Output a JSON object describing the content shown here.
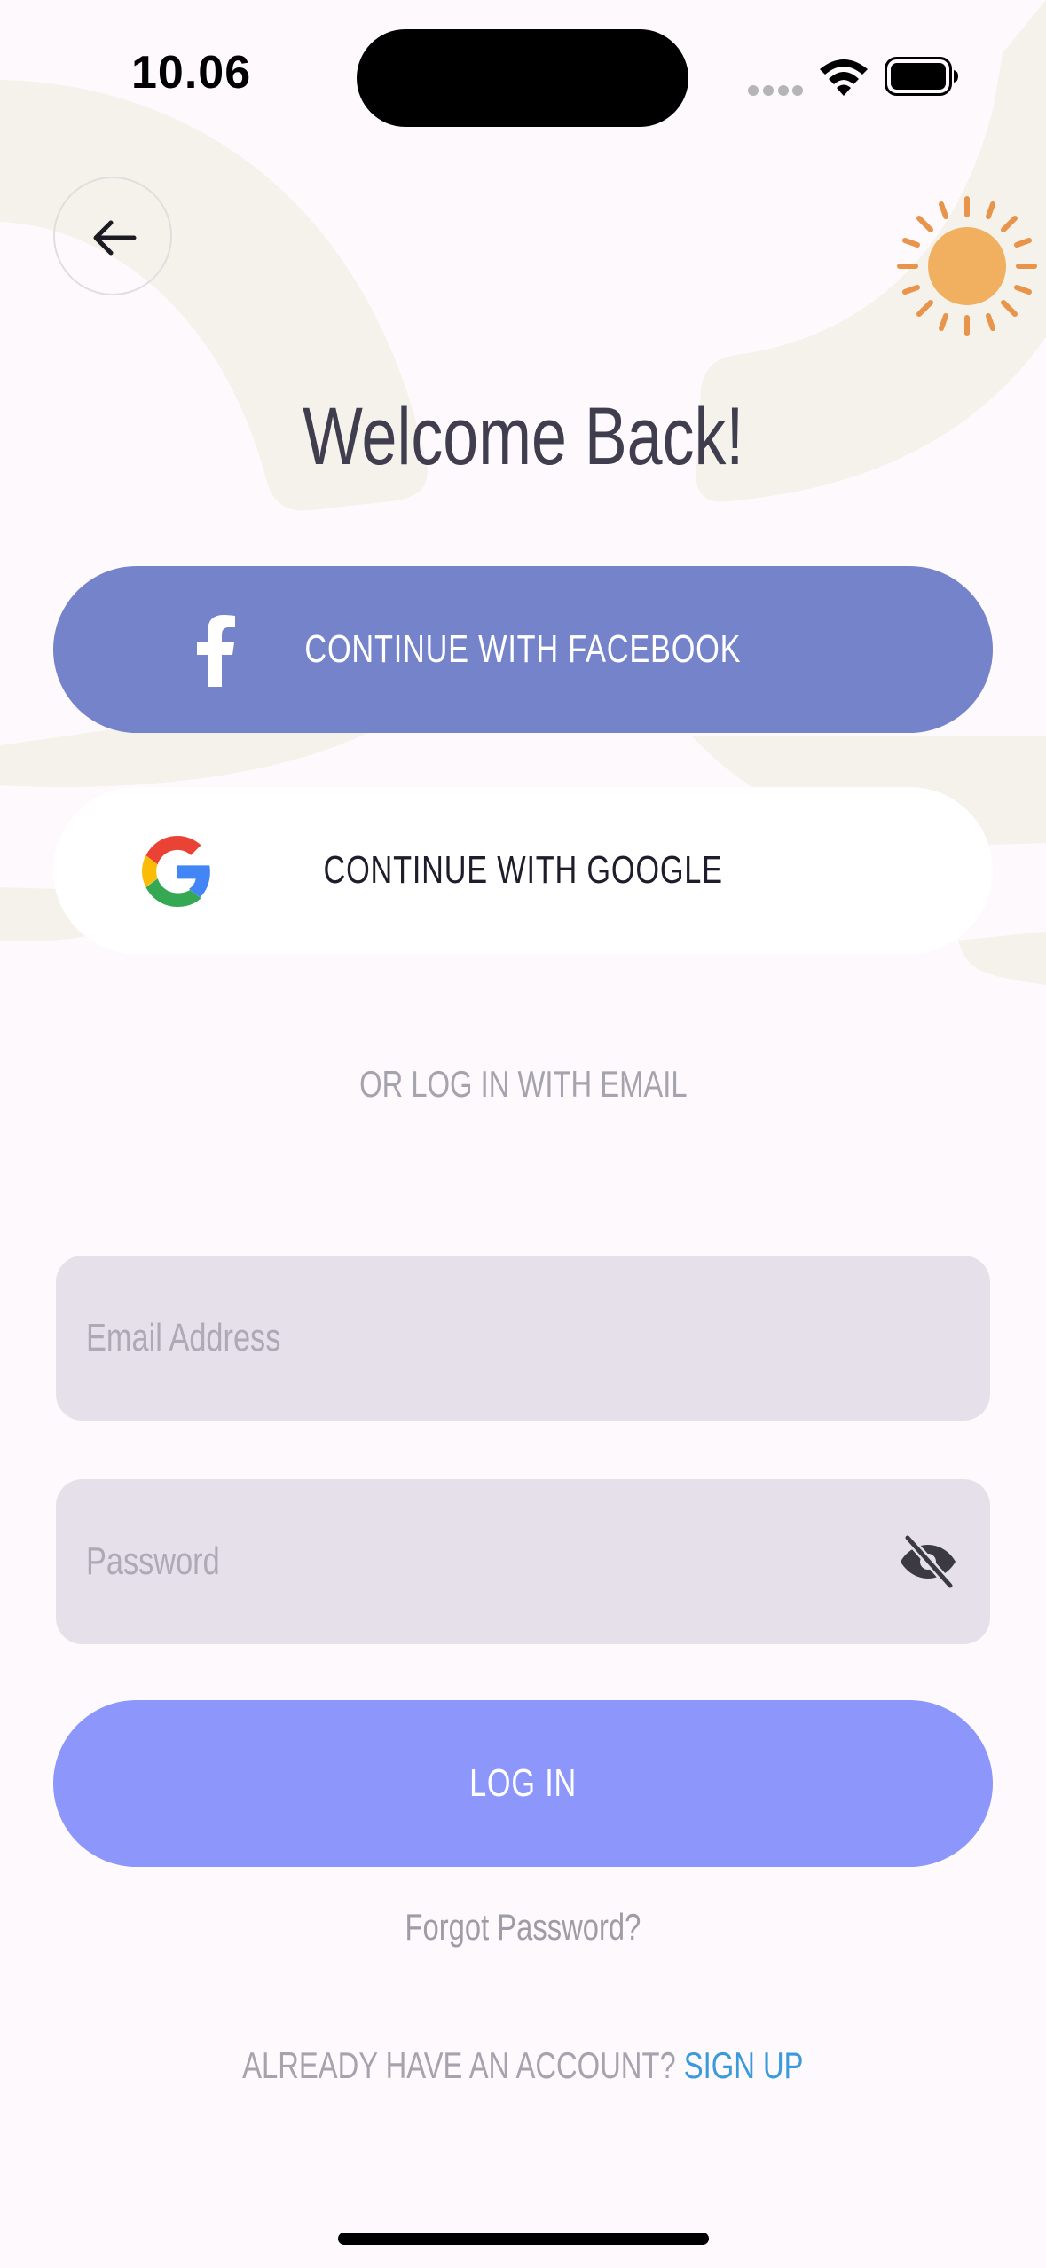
{
  "status_bar": {
    "time": "10.06"
  },
  "header": {
    "title": "Welcome Back!"
  },
  "social": {
    "facebook_label": "CONTINUE WITH FACEBOOK",
    "google_label": "CONTINUE WITH GOOGLE"
  },
  "divider": {
    "text": "OR LOG IN WITH EMAIL"
  },
  "form": {
    "email": {
      "value": "",
      "placeholder": "Email Address"
    },
    "password": {
      "value": "",
      "placeholder": "Password"
    },
    "login_label": "LOG IN",
    "forgot_label": "Forgot Password?"
  },
  "footer": {
    "prompt": "ALREADY HAVE AN ACCOUNT?",
    "signup_label": "SIGN UP"
  },
  "icons": {
    "back": "arrow-left-icon",
    "theme": "sun-icon",
    "facebook": "facebook-icon",
    "google": "google-icon",
    "password_visibility": "eye-off-icon",
    "wifi": "wifi-icon",
    "battery": "battery-icon"
  },
  "colors": {
    "background": "#fdf9fc",
    "facebook_button": "#7583ca",
    "google_button": "#ffffff",
    "login_button": "#8d96fb",
    "input_background": "#e5e0ea",
    "title_text": "#3f3d4e",
    "muted_text": "#a5a3ad",
    "link": "#3b9ad9",
    "sun": "#f0b060",
    "decorative_shape": "#f4f2ea"
  }
}
